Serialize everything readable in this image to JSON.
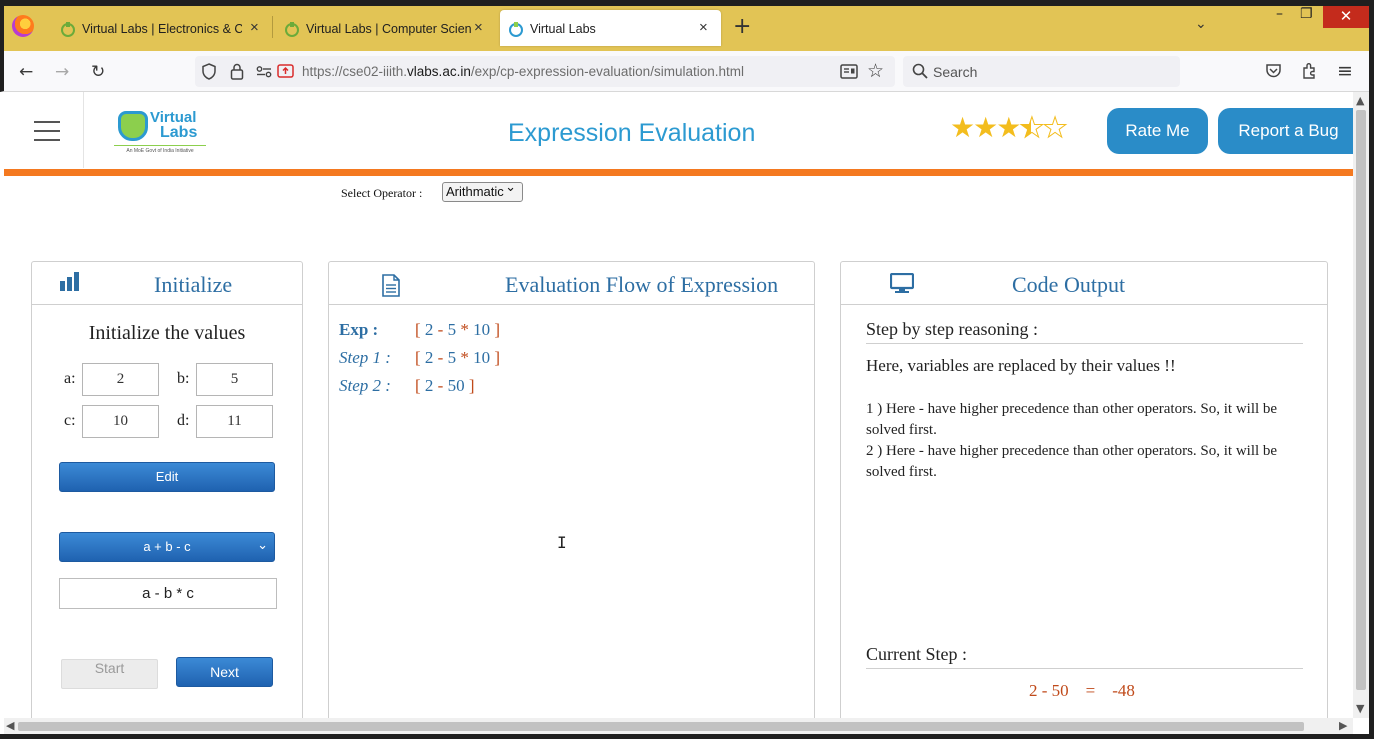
{
  "browser": {
    "tabs": [
      {
        "label": "Virtual Labs | Electronics & Com",
        "active": false
      },
      {
        "label": "Virtual Labs | Computer Science",
        "active": false
      },
      {
        "label": "Virtual Labs",
        "active": true
      }
    ],
    "close_glyph": "×",
    "new_tab_glyph": "+",
    "tab_list_glyph": "⌄",
    "window_controls": {
      "minimize": "–",
      "restore": "❐",
      "close": "✕"
    },
    "url": {
      "prefix": "https://cse02-iiith.",
      "domain": "vlabs.ac.in",
      "path": "/exp/cp-expression-evaluation/simulation.html"
    },
    "search_placeholder": "Search",
    "nav_glyphs": {
      "back": "←",
      "forward": "→",
      "reload": "↻",
      "menu": "≡"
    }
  },
  "header": {
    "logo": {
      "line1": "Virtual",
      "line2": "Labs",
      "tagline": "An MoE Govt of India Initiative"
    },
    "title": "Expression Evaluation",
    "rating": 3.5,
    "star_glyph": "★",
    "rate_button": "Rate Me",
    "bug_button": "Report a Bug",
    "colors": {
      "accent": "#2c9ad1",
      "bar": "#f47920",
      "button": "#2a8cc8"
    }
  },
  "operator": {
    "label": "Select Operator :",
    "selected": "Arithmatic"
  },
  "initialize": {
    "title": "Initialize",
    "subtitle": "Initialize the values",
    "vars": {
      "a": {
        "label": "a:",
        "value": "2"
      },
      "b": {
        "label": "b:",
        "value": "5"
      },
      "c": {
        "label": "c:",
        "value": "10"
      },
      "d": {
        "label": "d:",
        "value": "11"
      }
    },
    "edit_button": "Edit",
    "expression_select": "a + b - c",
    "expression_input": "a - b * c",
    "start_button": "Start",
    "next_button": "Next"
  },
  "flow": {
    "title": "Evaluation Flow of Expression",
    "rows": [
      {
        "label": "Exp :",
        "tokens": [
          "2",
          "-",
          "5",
          "*",
          "10"
        ]
      },
      {
        "label": "Step 1 :",
        "tokens": [
          "2",
          "-",
          "5",
          "*",
          "10"
        ]
      },
      {
        "label": "Step 2 :",
        "tokens": [
          "2",
          "-",
          "50"
        ]
      }
    ]
  },
  "output": {
    "title": "Code Output",
    "reasoning_heading": "Step by step reasoning :",
    "intro": "Here, variables are replaced by their values !!",
    "steps": [
      "1 ) Here - have higher precedence than other operators. So, it will be solved first.",
      "2 ) Here - have higher precedence than other operators. So, it will be solved first."
    ],
    "current_heading": "Current Step :",
    "current_step": "2 - 50    =    -48"
  }
}
